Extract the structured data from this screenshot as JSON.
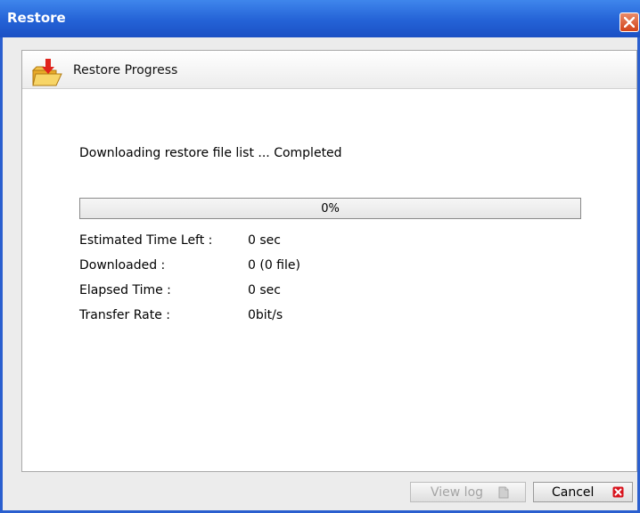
{
  "window": {
    "title": "Restore"
  },
  "panel": {
    "title": "Restore Progress"
  },
  "status": {
    "message": "Downloading restore file list ... Completed"
  },
  "progress": {
    "value": 0,
    "label": "0%"
  },
  "stats": [
    {
      "label": "Estimated Time Left :",
      "value": "0 sec"
    },
    {
      "label": "Downloaded :",
      "value": "0 (0 file)"
    },
    {
      "label": "Elapsed Time :",
      "value": "0 sec"
    },
    {
      "label": "Transfer Rate :",
      "value": "0bit/s"
    }
  ],
  "buttons": {
    "view_log": {
      "label": "View log",
      "enabled": false
    },
    "cancel": {
      "label": "Cancel"
    }
  },
  "colors": {
    "titlebar": "#2462d6",
    "close": "#d24319",
    "progress_fill": "#3c79d8",
    "cancel_icon": "#d8131d"
  }
}
